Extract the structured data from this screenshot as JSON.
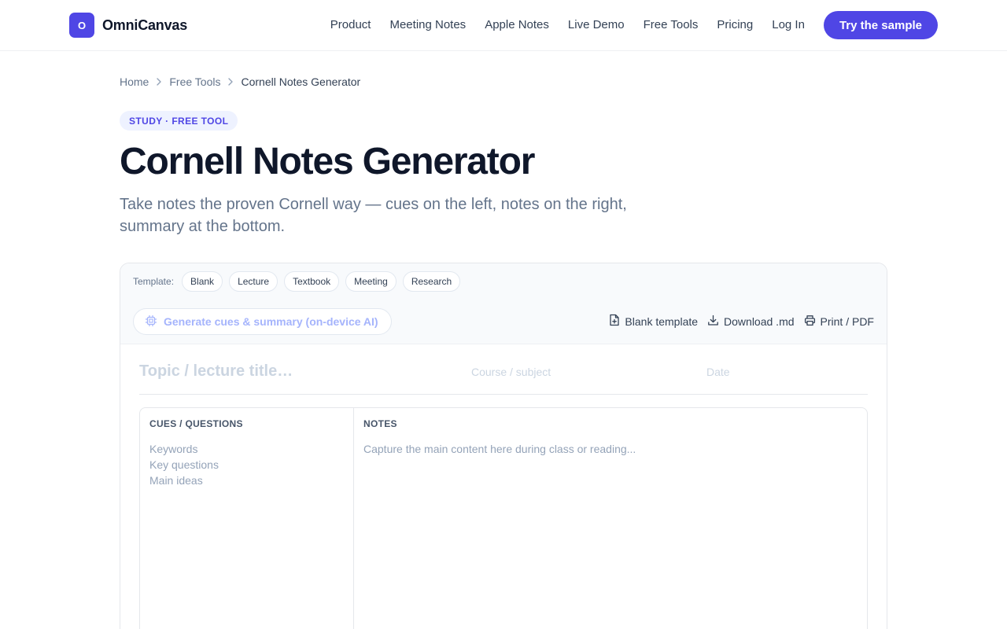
{
  "header": {
    "logo_letter": "O",
    "brand": "OmniCanvas",
    "nav": [
      "Product",
      "Meeting Notes",
      "Apple Notes",
      "Live Demo",
      "Free Tools",
      "Pricing",
      "Log In"
    ],
    "cta": "Try the sample",
    "accent": "#4f46e5"
  },
  "breadcrumb": {
    "home": "Home",
    "section": "Free Tools",
    "current": "Cornell Notes Generator",
    "separator_icon": "chevron-right-icon"
  },
  "hero": {
    "badge": "STUDY · FREE TOOL",
    "title": "Cornell Notes Generator",
    "subtitle": "Take notes the proven Cornell way — cues on the left, notes on the right, summary at the bottom."
  },
  "toolbar": {
    "template_label": "Template:",
    "templates": [
      "Blank",
      "Lecture",
      "Textbook",
      "Meeting",
      "Research"
    ],
    "ai_button": "Generate cues & summary (on-device AI)",
    "ai_icon": "chip-icon",
    "actions": {
      "blank_template": "Blank template",
      "download_md": "Download .md",
      "print_pdf": "Print / PDF"
    }
  },
  "form": {
    "topic_placeholder": "Topic / lecture title…",
    "topic_value": "",
    "course_placeholder": "Course / subject",
    "course_value": "",
    "date_placeholder": "Date",
    "date_value": ""
  },
  "cornell": {
    "cues_heading": "CUES / QUESTIONS",
    "cues_placeholder": "Keywords\nKey questions\nMain ideas",
    "cues_value": "",
    "notes_heading": "NOTES",
    "notes_placeholder": "Capture the main content here during class or reading...",
    "notes_value": ""
  }
}
